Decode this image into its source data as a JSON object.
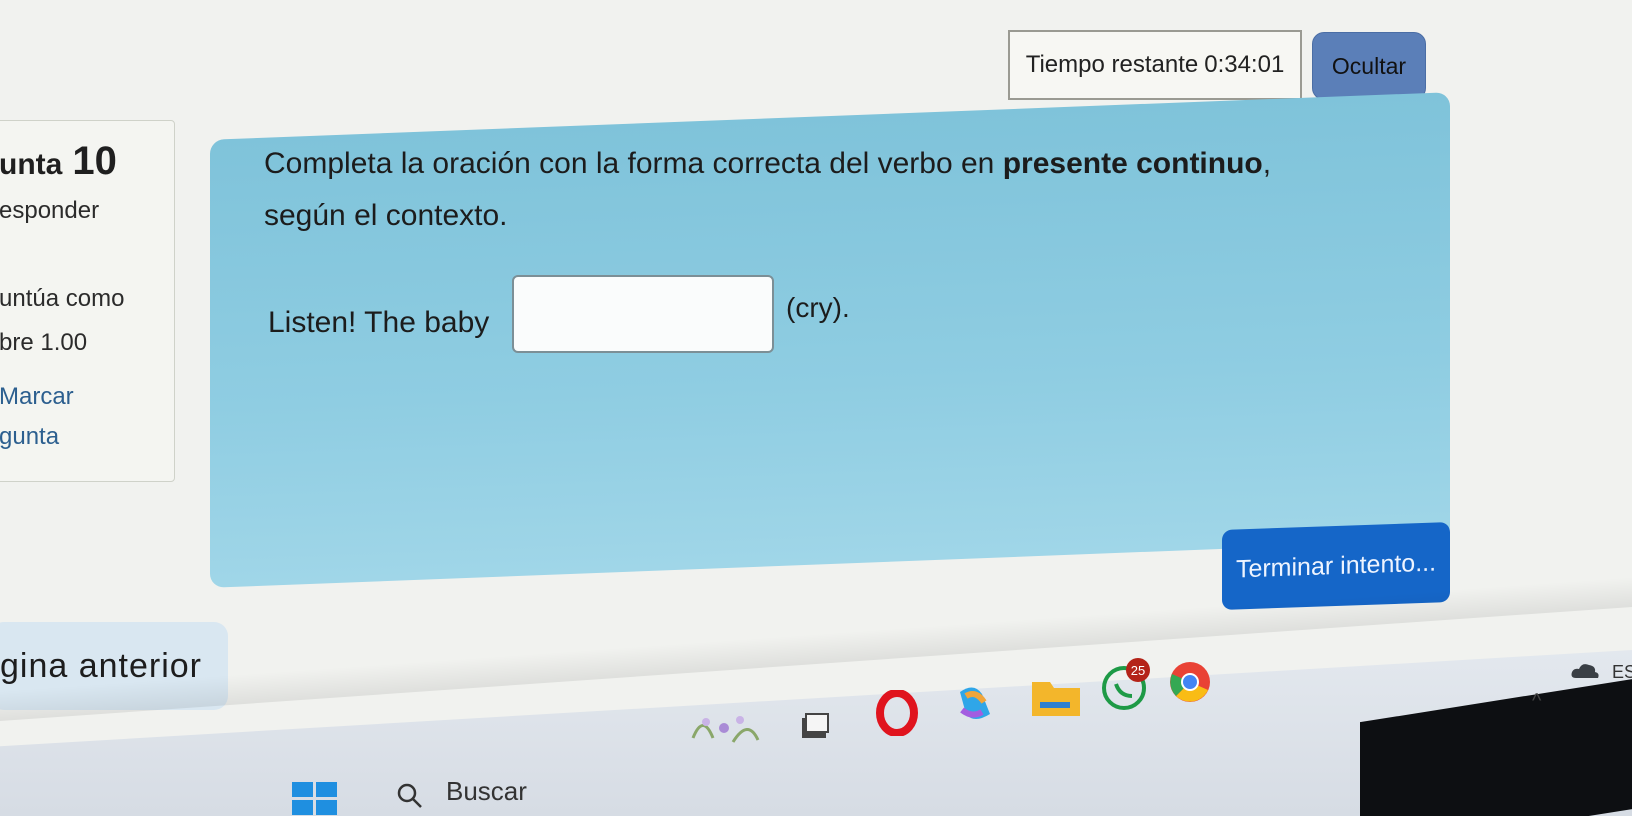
{
  "timer": {
    "label": "Tiempo restante",
    "value": "0:34:01"
  },
  "hide_button": "Ocultar",
  "question_info": {
    "title": "unta",
    "number": "10",
    "status": "esponder",
    "points_label": "untúa como",
    "points_value": "bre 1.00",
    "flag_line1": "Marcar",
    "flag_line2": "gunta"
  },
  "question": {
    "instruction_pre": "Completa la oración con la forma correcta del verbo en ",
    "instruction_bold": "presente continuo",
    "instruction_post": ", según el contexto.",
    "sentence": "Listen! The baby",
    "hint": "(cry).",
    "answer_value": ""
  },
  "finish_button": "Terminar intento...",
  "prev_button": "gina anterior",
  "taskbar": {
    "search_placeholder": "Buscar",
    "badge": "25",
    "lang": "ES",
    "tray_chevron": "^"
  },
  "colors": {
    "question_bg": "#8fcde2",
    "finish_bg": "#1566c8",
    "hide_bg": "#5b7fb8",
    "prev_bg": "#d9e7f1"
  }
}
